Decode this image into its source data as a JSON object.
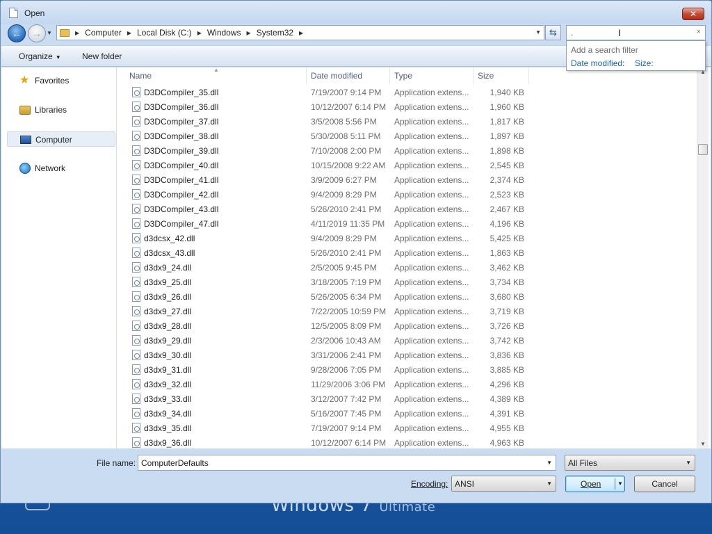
{
  "window": {
    "title": "Open"
  },
  "nav": {
    "breadcrumbs": [
      "Computer",
      "Local Disk (C:)",
      "Windows",
      "System32"
    ],
    "search_value": ".",
    "search_clear": "×",
    "back_glyph": "←",
    "forward_glyph": "→",
    "refresh_glyph": "⇆"
  },
  "search_filter": {
    "title": "Add a search filter",
    "filters": [
      "Date modified:",
      "Size:"
    ]
  },
  "toolbar": {
    "organize": "Organize",
    "new_folder": "New folder"
  },
  "sidebar": {
    "items": [
      {
        "label": "Favorites",
        "icon": "star-icon"
      },
      {
        "label": "Libraries",
        "icon": "libraries-icon"
      },
      {
        "label": "Computer",
        "icon": "computer-icon"
      },
      {
        "label": "Network",
        "icon": "network-icon"
      }
    ]
  },
  "columns": {
    "name": "Name",
    "date": "Date modified",
    "type": "Type",
    "size": "Size"
  },
  "files": [
    {
      "name": "D3DCompiler_35.dll",
      "date": "7/19/2007 9:14 PM",
      "type": "Application extens...",
      "size": "1,940 KB"
    },
    {
      "name": "D3DCompiler_36.dll",
      "date": "10/12/2007 6:14 PM",
      "type": "Application extens...",
      "size": "1,960 KB"
    },
    {
      "name": "D3DCompiler_37.dll",
      "date": "3/5/2008 5:56 PM",
      "type": "Application extens...",
      "size": "1,817 KB"
    },
    {
      "name": "D3DCompiler_38.dll",
      "date": "5/30/2008 5:11 PM",
      "type": "Application extens...",
      "size": "1,897 KB"
    },
    {
      "name": "D3DCompiler_39.dll",
      "date": "7/10/2008 2:00 PM",
      "type": "Application extens...",
      "size": "1,898 KB"
    },
    {
      "name": "D3DCompiler_40.dll",
      "date": "10/15/2008 9:22 AM",
      "type": "Application extens...",
      "size": "2,545 KB"
    },
    {
      "name": "D3DCompiler_41.dll",
      "date": "3/9/2009 6:27 PM",
      "type": "Application extens...",
      "size": "2,374 KB"
    },
    {
      "name": "D3DCompiler_42.dll",
      "date": "9/4/2009 8:29 PM",
      "type": "Application extens...",
      "size": "2,523 KB"
    },
    {
      "name": "D3DCompiler_43.dll",
      "date": "5/26/2010 2:41 PM",
      "type": "Application extens...",
      "size": "2,467 KB"
    },
    {
      "name": "D3DCompiler_47.dll",
      "date": "4/11/2019 11:35 PM",
      "type": "Application extens...",
      "size": "4,196 KB"
    },
    {
      "name": "d3dcsx_42.dll",
      "date": "9/4/2009 8:29 PM",
      "type": "Application extens...",
      "size": "5,425 KB"
    },
    {
      "name": "d3dcsx_43.dll",
      "date": "5/26/2010 2:41 PM",
      "type": "Application extens...",
      "size": "1,863 KB"
    },
    {
      "name": "d3dx9_24.dll",
      "date": "2/5/2005 9:45 PM",
      "type": "Application extens...",
      "size": "3,462 KB"
    },
    {
      "name": "d3dx9_25.dll",
      "date": "3/18/2005 7:19 PM",
      "type": "Application extens...",
      "size": "3,734 KB"
    },
    {
      "name": "d3dx9_26.dll",
      "date": "5/26/2005 6:34 PM",
      "type": "Application extens...",
      "size": "3,680 KB"
    },
    {
      "name": "d3dx9_27.dll",
      "date": "7/22/2005 10:59 PM",
      "type": "Application extens...",
      "size": "3,719 KB"
    },
    {
      "name": "d3dx9_28.dll",
      "date": "12/5/2005 8:09 PM",
      "type": "Application extens...",
      "size": "3,726 KB"
    },
    {
      "name": "d3dx9_29.dll",
      "date": "2/3/2006 10:43 AM",
      "type": "Application extens...",
      "size": "3,742 KB"
    },
    {
      "name": "d3dx9_30.dll",
      "date": "3/31/2006 2:41 PM",
      "type": "Application extens...",
      "size": "3,836 KB"
    },
    {
      "name": "d3dx9_31.dll",
      "date": "9/28/2006 7:05 PM",
      "type": "Application extens...",
      "size": "3,885 KB"
    },
    {
      "name": "d3dx9_32.dll",
      "date": "11/29/2006 3:06 PM",
      "type": "Application extens...",
      "size": "4,296 KB"
    },
    {
      "name": "d3dx9_33.dll",
      "date": "3/12/2007 7:42 PM",
      "type": "Application extens...",
      "size": "4,389 KB"
    },
    {
      "name": "d3dx9_34.dll",
      "date": "5/16/2007 7:45 PM",
      "type": "Application extens...",
      "size": "4,391 KB"
    },
    {
      "name": "d3dx9_35.dll",
      "date": "7/19/2007 9:14 PM",
      "type": "Application extens...",
      "size": "4,955 KB"
    },
    {
      "name": "d3dx9_36.dll",
      "date": "10/12/2007 6:14 PM",
      "type": "Application extens...",
      "size": "4,963 KB"
    }
  ],
  "bottom": {
    "filename_label": "File name:",
    "filename_value": "ComputerDefaults",
    "filetype_value": "All Files",
    "encoding_label": "Encoding:",
    "encoding_value": "ANSI",
    "open_label": "Open",
    "cancel_label": "Cancel"
  },
  "desktop": {
    "brand": "Windows 7",
    "edition": "Ultimate"
  }
}
